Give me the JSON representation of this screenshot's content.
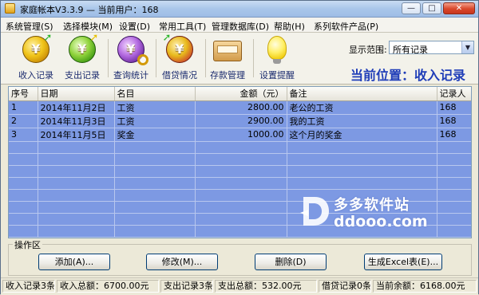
{
  "window": {
    "title": "家庭帐本V3.3.9  —  当前用户：168"
  },
  "menu": [
    "系统管理(S)",
    "选择模块(M)",
    "设置(D)",
    "常用工具(T)",
    "管理数据库(D)",
    "帮助(H)",
    "系列软件产品(P)"
  ],
  "toolbar": {
    "income": "收入记录",
    "expense": "支出记录",
    "query": "查询统计",
    "loan": "借贷情况",
    "deposit": "存款管理",
    "reminder": "设置提醒",
    "yen_symbol": "¥"
  },
  "scope": {
    "label": "显示范围:",
    "value": "所有记录"
  },
  "location": "当前位置：收入记录",
  "table": {
    "headers": [
      "序号",
      "日期",
      "名目",
      "金额（元）",
      "备注",
      "记录人"
    ],
    "rows": [
      [
        "1",
        "2014年11月2日",
        "工资",
        "2800.00",
        "老公的工资",
        "168"
      ],
      [
        "2",
        "2014年11月3日",
        "工资",
        "2900.00",
        "我的工资",
        "168"
      ],
      [
        "3",
        "2014年11月5日",
        "奖金",
        "1000.00",
        "这个月的奖金",
        "168"
      ]
    ]
  },
  "watermark": {
    "cn": "多多软件站",
    "en": "ddooo.com"
  },
  "ops": {
    "legend": "操作区",
    "add": "添加(A)...",
    "edit": "修改(M)...",
    "delete": "删除(D)",
    "excel": "生成Excel表(E)..."
  },
  "status": [
    "收入记录3条",
    "收入总额：6700.00元",
    "支出记录3条",
    "支出总额：532.00元",
    "借贷记录0条",
    "当前余额：6168.00元"
  ],
  "colors": {
    "grid_row": "#7d99e3",
    "location_text": "#1f3db8"
  }
}
